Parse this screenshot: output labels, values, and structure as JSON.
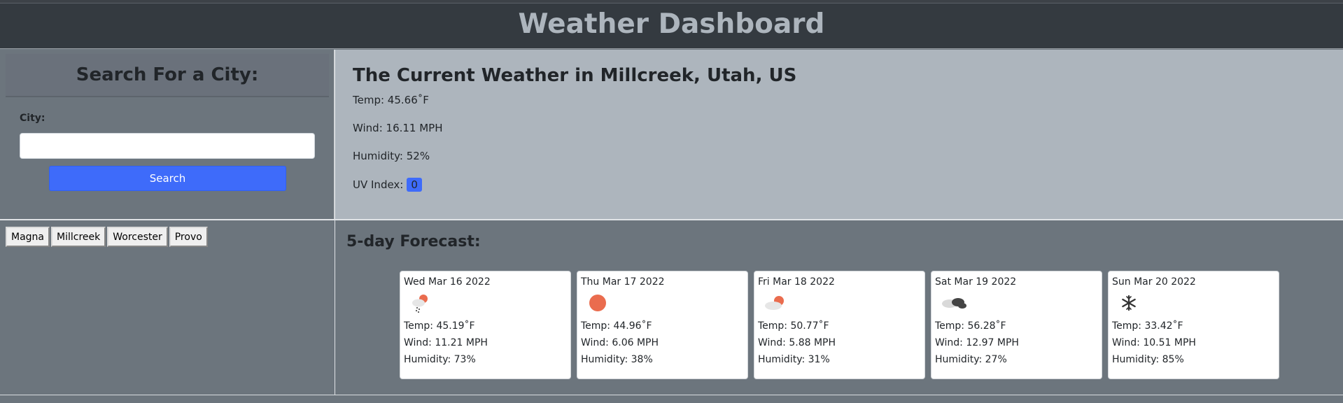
{
  "header": {
    "title": "Weather Dashboard"
  },
  "search": {
    "heading": "Search For a City:",
    "city_label": "City:",
    "input_value": "",
    "button_label": "Search"
  },
  "current": {
    "title": "The Current Weather in Millcreek, Utah, US",
    "temp": "Temp: 45.66˚F",
    "wind": "Wind: 16.11 MPH",
    "humidity": "Humidity: 52%",
    "uv_label": "UV Index:",
    "uv_value": "0"
  },
  "history": {
    "cities": [
      "Magna",
      "Millcreek",
      "Worcester",
      "Provo"
    ]
  },
  "forecast": {
    "title": "5-day Forecast:",
    "days": [
      {
        "date": "Wed Mar 16 2022",
        "icon": "sun-cloud-rain-icon",
        "temp": "Temp: 45.19˚F",
        "wind": "Wind: 11.21 MPH",
        "humidity": "Humidity: 73%"
      },
      {
        "date": "Thu Mar 17 2022",
        "icon": "sun-icon",
        "temp": "Temp: 44.96˚F",
        "wind": "Wind: 6.06 MPH",
        "humidity": "Humidity: 38%"
      },
      {
        "date": "Fri Mar 18 2022",
        "icon": "sun-cloud-icon",
        "temp": "Temp: 50.77˚F",
        "wind": "Wind: 5.88 MPH",
        "humidity": "Humidity: 31%"
      },
      {
        "date": "Sat Mar 19 2022",
        "icon": "dark-clouds-icon",
        "temp": "Temp: 56.28˚F",
        "wind": "Wind: 12.97 MPH",
        "humidity": "Humidity: 27%"
      },
      {
        "date": "Sun Mar 20 2022",
        "icon": "snowflake-icon",
        "temp": "Temp: 33.42˚F",
        "wind": "Wind: 10.51 MPH",
        "humidity": "Humidity: 85%"
      }
    ]
  },
  "colors": {
    "header_bg": "#343a40",
    "header_text": "#adb5bd",
    "current_bg": "#adb5bd",
    "panel_bg": "#6c757d",
    "accent": "#3e6bfa",
    "sun": "#ea6c4e"
  }
}
